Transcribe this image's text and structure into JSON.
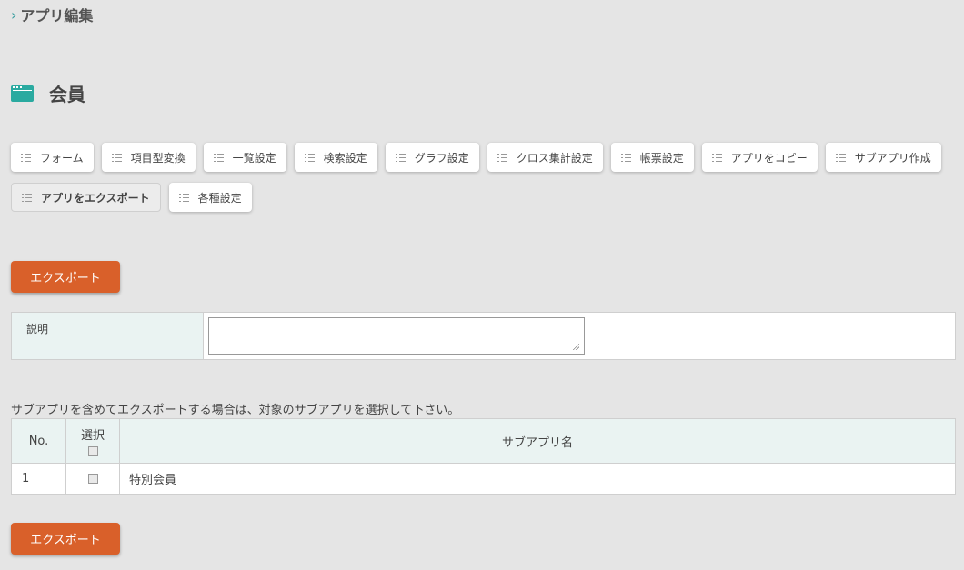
{
  "breadcrumb": {
    "icon": "chevron-right-icon",
    "label": "アプリ編集"
  },
  "app": {
    "icon": "app-window-icon",
    "name": "会員"
  },
  "toolbar": {
    "row1": [
      "フォーム",
      "項目型変換",
      "一覧設定",
      "検索設定",
      "グラフ設定",
      "クロス集計設定",
      "帳票設定",
      "アプリをコピー",
      "サブアプリ作成"
    ],
    "row2": [
      "アプリをエクスポート",
      "各種設定"
    ],
    "active": "アプリをエクスポート",
    "item_icon": "list-icon"
  },
  "export_button": "エクスポート",
  "description": {
    "label": "説明",
    "value": ""
  },
  "subapp_note": "サブアプリを含めてエクスポートする場合は、対象のサブアプリを選択して下さい。",
  "subapp_table": {
    "headers": {
      "no": "No.",
      "select": "選択",
      "name": "サブアプリ名"
    },
    "rows": [
      {
        "no": "1",
        "name": "特別会員",
        "checked": false
      }
    ]
  },
  "colors": {
    "accent": "#d9602a",
    "teal": "#2aaaa0",
    "header_bg": "#eaf3f2",
    "page_bg": "#e5e5e5"
  }
}
